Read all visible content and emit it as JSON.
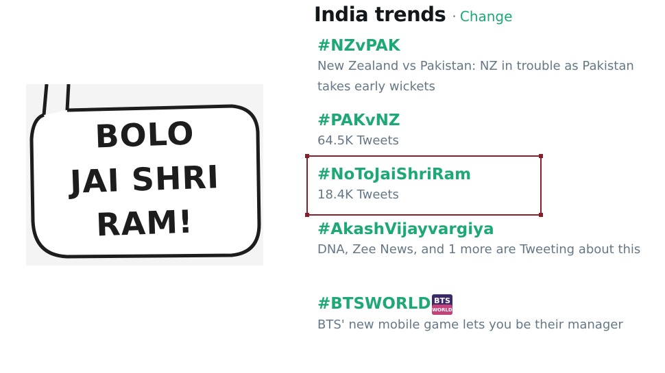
{
  "bubble": {
    "lines": [
      "BOLO",
      "JAI SHRI",
      "RAM!"
    ]
  },
  "trends": {
    "title": "India trends",
    "separator": "·",
    "change_label": "Change",
    "items": [
      {
        "name": "#NZvPAK",
        "description": "New Zealand vs Pakistan: NZ in trouble as Pakistan takes early wickets"
      },
      {
        "name": "#PAKvNZ",
        "description": "64.5K Tweets"
      },
      {
        "name": "#NoToJaiShriRam",
        "description": "18.4K Tweets"
      },
      {
        "name": "#AkashVijayvargiya",
        "description": "DNA, Zee News, and 1 more are Tweeting about this"
      },
      {
        "name": "#BTSWORLD",
        "description": "BTS' new mobile game lets you be their manager",
        "badge": "BTS WORLD"
      }
    ]
  },
  "colors": {
    "trend_green": "#1da876",
    "highlight": "#8b1d2a",
    "muted": "#657786"
  }
}
